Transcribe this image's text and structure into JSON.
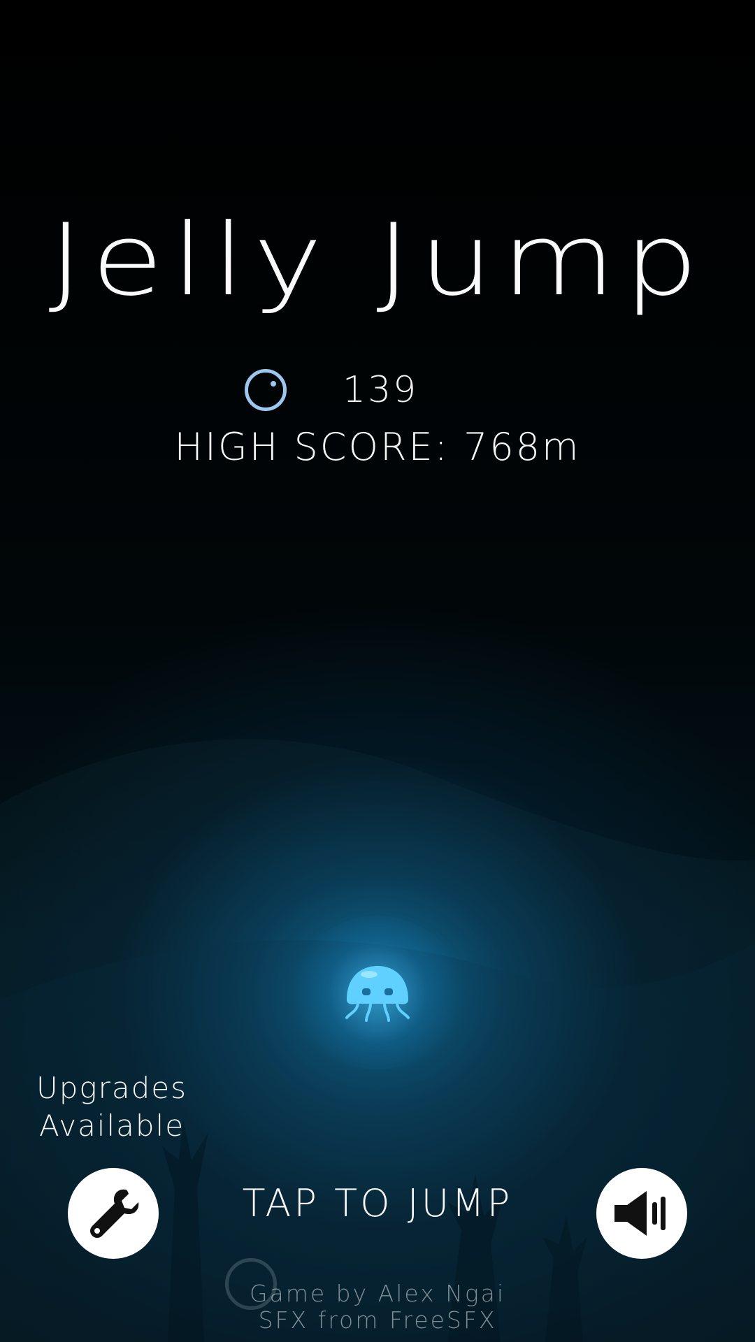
{
  "game": {
    "title": "Jelly Jump",
    "bubble_count": "139",
    "high_score_text": "HIGH SCORE: 768m",
    "upgrades_line1": "Upgrades",
    "upgrades_line2": "Available",
    "tap_prompt": "TAP TO JUMP",
    "credit_line1": "Game by Alex Ngai",
    "credit_line2": "SFX from FreeSFX"
  },
  "icons": {
    "bubble": "bubble-icon",
    "upgrades": "wrench-icon",
    "sound": "speaker-icon",
    "player": "jellyfish-icon"
  },
  "colors": {
    "background": "#000000",
    "glow": "#1a8cc4",
    "jelly": "#5fd0ff",
    "bubble_icon": "#9cc8ef",
    "text": "#ffffff"
  }
}
